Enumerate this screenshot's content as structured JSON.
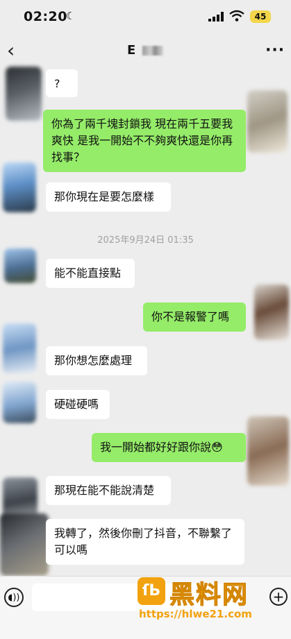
{
  "status": {
    "time": "02:20",
    "battery": "45"
  },
  "nav": {
    "title": "E",
    "back_icon": "‹",
    "more_icon": "···"
  },
  "messages": [
    {
      "side": "left",
      "text": "?"
    },
    {
      "side": "right",
      "text": "你為了兩千塊封鎖我 現在兩千五要我爽快 是我一開始不不夠爽快還是你再找事？"
    },
    {
      "side": "left",
      "text": "那你現在是要怎麼樣"
    },
    {
      "side": "left",
      "text": "能不能直接點"
    },
    {
      "side": "right",
      "text": "你不是報警了嗎"
    },
    {
      "side": "left",
      "text": "那你想怎麼處理"
    },
    {
      "side": "left",
      "text": "硬碰硬嗎"
    },
    {
      "side": "right",
      "text": "我一開始都好好跟你說",
      "emoji": "😳"
    },
    {
      "side": "left",
      "text": "那現在能不能說清楚"
    },
    {
      "side": "left",
      "text": "我轉了，然後你刪了抖音，不聯繫了可以嗎"
    }
  ],
  "timestamp": "2025年9月24日 01:35",
  "watermark": {
    "logo": "ſЬ",
    "text": "黑料网",
    "url": "https://hlwe21.com"
  },
  "colors": {
    "background": "#ededed",
    "sent_bubble": "#95ec69",
    "received_bubble": "#ffffff",
    "watermark": "#f2a20e"
  }
}
